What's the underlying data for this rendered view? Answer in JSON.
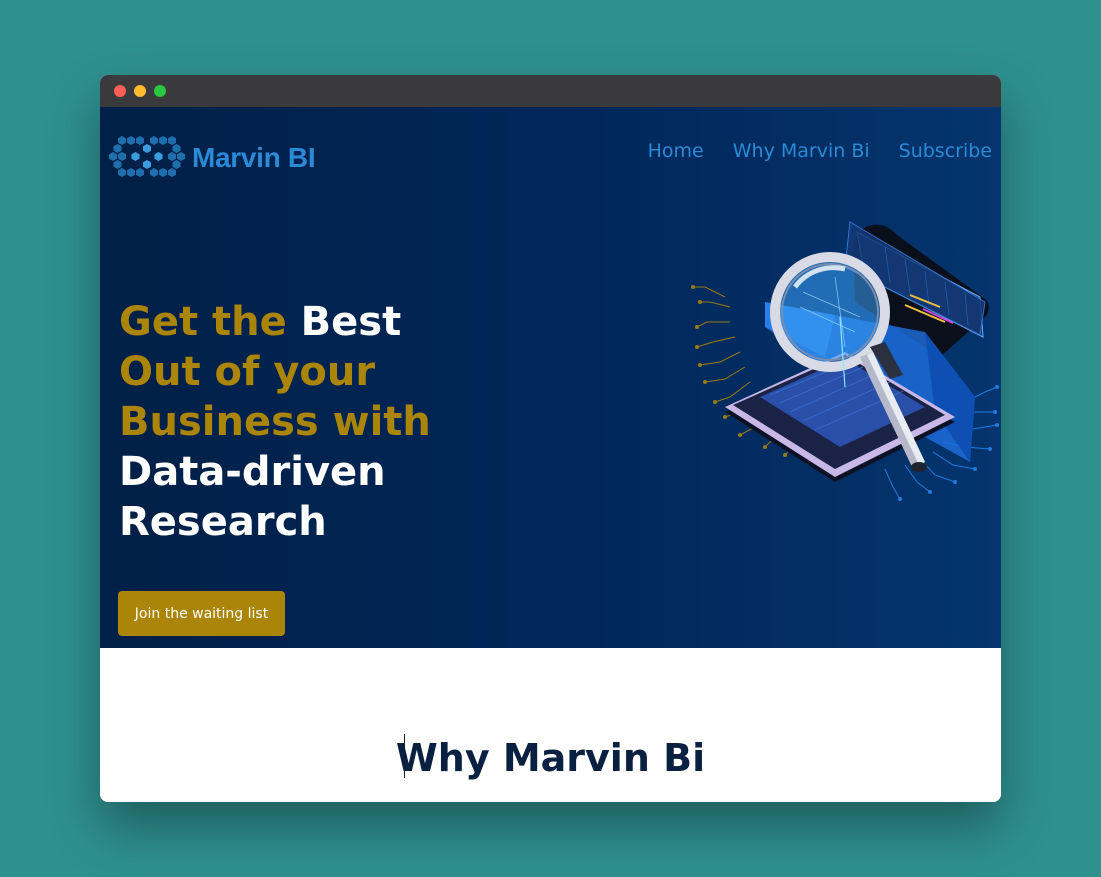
{
  "window": {
    "controls": [
      "close",
      "minimize",
      "maximize"
    ],
    "colors": {
      "close": "#ff5f57",
      "minimize": "#febc2e",
      "maximize": "#28c840"
    }
  },
  "brand": {
    "name": "Marvin BI",
    "logo_icon": "hexagon-network-icon",
    "color": "#2a8ad6"
  },
  "nav": {
    "home": "Home",
    "why": "Why Marvin Bi",
    "subscribe": "Subscribe"
  },
  "hero": {
    "headline": {
      "part1": "Get the",
      "part2": "Best",
      "part3": "Out of your",
      "part4": "Business with",
      "part5": "Data-driven",
      "part6": "Research"
    },
    "cta_label": "Join the waiting list",
    "illustration": "magnifying-glass-laptop-illustration",
    "colors": {
      "accent": "#ab8507",
      "background": "#012047"
    }
  },
  "section": {
    "title": "Why Marvin Bi",
    "color": "#0a2040"
  }
}
